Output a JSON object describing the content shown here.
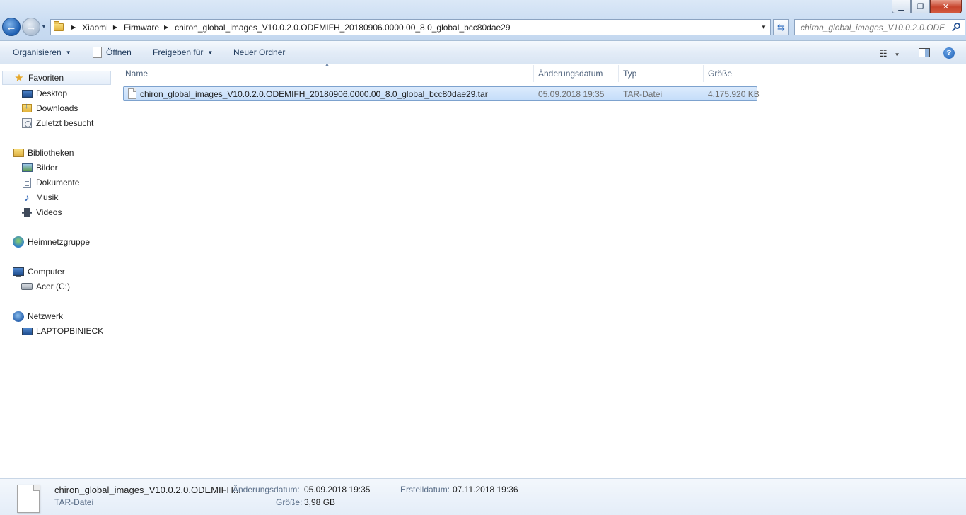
{
  "addressbar": {
    "crumbs": [
      "Xiaomi",
      "Firmware",
      "chiron_global_images_V10.0.2.0.ODEMIFH_20180906.0000.00_8.0_global_bcc80dae29"
    ]
  },
  "search": {
    "placeholder": "chiron_global_images_V10.0.2.0.ODE..."
  },
  "toolbar": {
    "organize": "Organisieren",
    "open": "Öffnen",
    "share": "Freigeben für",
    "new_folder": "Neuer Ordner"
  },
  "navpane": {
    "favorites": "Favoriten",
    "desktop": "Desktop",
    "downloads": "Downloads",
    "recent": "Zuletzt besucht",
    "libraries": "Bibliotheken",
    "pictures": "Bilder",
    "documents": "Dokumente",
    "music": "Musik",
    "videos": "Videos",
    "homegroup": "Heimnetzgruppe",
    "computer": "Computer",
    "drive_c": "Acer (C:)",
    "network": "Netzwerk",
    "network_pc": "LAPTOPBINIECK"
  },
  "columns": {
    "name": "Name",
    "date": "Änderungsdatum",
    "type": "Typ",
    "size": "Größe"
  },
  "files": [
    {
      "name": "chiron_global_images_V10.0.2.0.ODEMIFH_20180906.0000.00_8.0_global_bcc80dae29.tar",
      "date": "05.09.2018 19:35",
      "type": "TAR-Datei",
      "size": "4.175.920 KB"
    }
  ],
  "details": {
    "name": "chiron_global_images_V10.0.2.0.ODEMIFH...",
    "type": "TAR-Datei",
    "modified_label": "Änderungsdatum:",
    "modified_value": "05.09.2018 19:35",
    "size_label": "Größe:",
    "size_value": "3,98 GB",
    "created_label": "Erstelldatum:",
    "created_value": "07.11.2018 19:36"
  }
}
